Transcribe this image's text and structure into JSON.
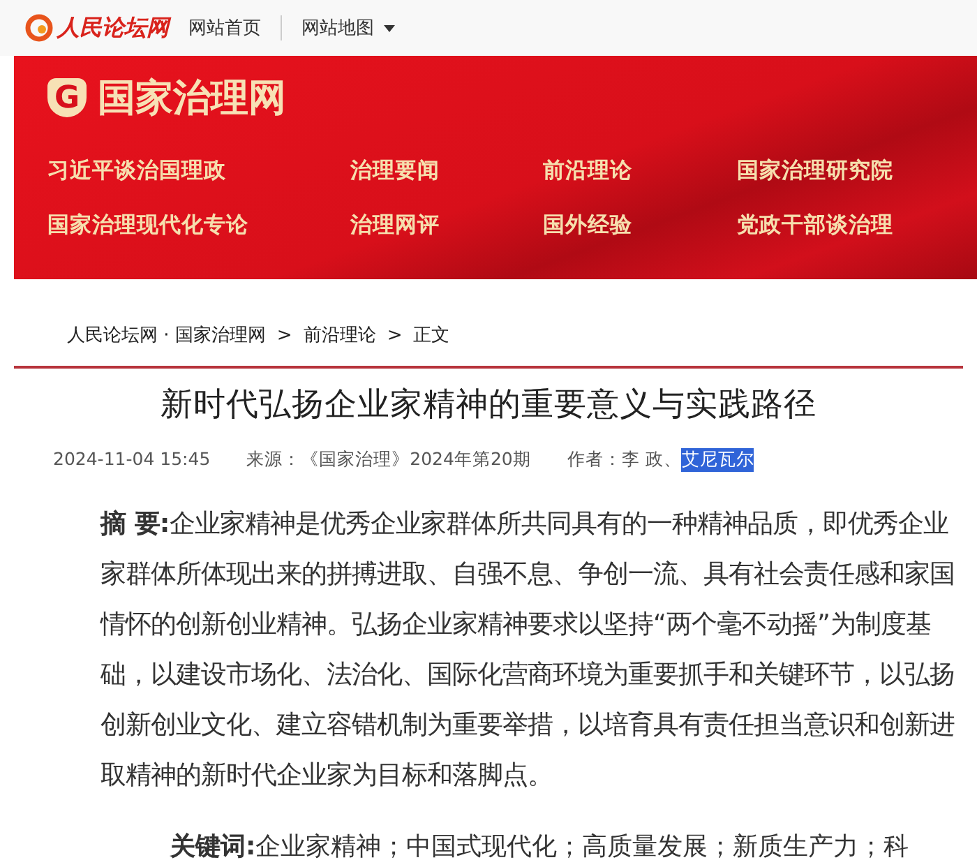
{
  "top_bar": {
    "logo": "人民论坛网",
    "links": [
      {
        "label": "网站首页",
        "dropdown": false
      },
      {
        "label": "网站地图",
        "dropdown": true
      }
    ]
  },
  "banner": {
    "logo_letter": "G",
    "site_name": "国家治理网",
    "nav": [
      {
        "label": "习近平谈治国理政"
      },
      {
        "label": "治理要闻"
      },
      {
        "label": "前沿理论"
      },
      {
        "label": "国家治理研究院"
      },
      {
        "label": "国家治理现代化专论"
      },
      {
        "label": "治理网评"
      },
      {
        "label": "国外经验"
      },
      {
        "label": "党政干部谈治理"
      }
    ]
  },
  "breadcrumb": [
    {
      "label": "人民论坛网 · 国家治理网"
    },
    {
      "label": "前沿理论"
    },
    {
      "label": "正文"
    }
  ],
  "breadcrumb_separator": ">",
  "article": {
    "title": "新时代弘扬企业家精神的重要意义与实践路径",
    "date": "2024-11-04 15:45",
    "source": "来源：《国家治理》2024年第20期",
    "author_label": "作者：",
    "authors": [
      {
        "name": "李 政、",
        "highlighted": false
      },
      {
        "name": "艾尼瓦尔",
        "highlighted": true
      }
    ],
    "abstract": "**摘 要:**企业家精神是优秀企业家群体所共同具有的一种精神品质，即优秀企业家群体所体现出来的拼搏进取、自强不息、争创一流、具有社会责任感和家国情怀的创新创业精神。弘扬企业家精神要求以坚持“两个毫不动摇”为制度基础，以建设市场化、法治化、国际化营商环境为重要抓手和关键环节，以弘扬创新创业文化、建立容错机制为重要举措，以培育具有责任担当意识和创新进取精神的新时代企业家为目标和落脚点。",
    "keywords": "**关键词:**企业家精神；中国式现代化；高质量发展；新质生产力；科"
  }
}
